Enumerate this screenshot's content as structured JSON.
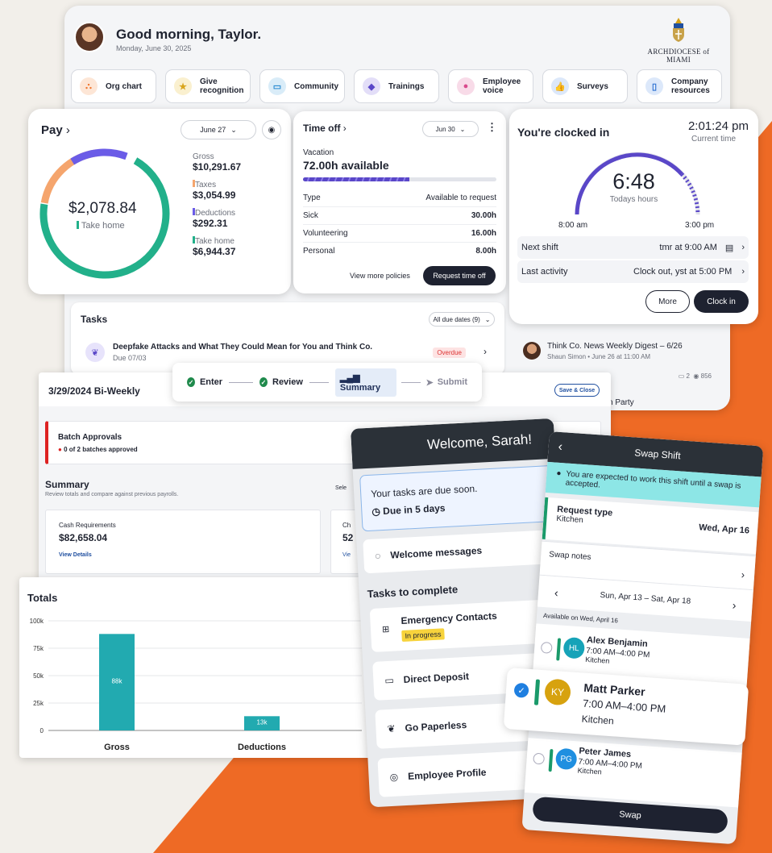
{
  "header": {
    "greeting": "Good morning, Taylor.",
    "date": "Monday, June 30, 2025",
    "org_logo_text": "ARCHDIOCESE of MIAMI"
  },
  "quick_actions": [
    {
      "label": "Org chart",
      "icon": "org-chart-icon",
      "color": "#f1742b"
    },
    {
      "label": "Give recognition",
      "icon": "star-icon",
      "color": "#d9a51c"
    },
    {
      "label": "Community",
      "icon": "chat-icon",
      "color": "#2a8bd1"
    },
    {
      "label": "Trainings",
      "icon": "graduation-cap-icon",
      "color": "#5a47c8"
    },
    {
      "label": "Employee voice",
      "icon": "microphone-icon",
      "color": "#d94a8c"
    },
    {
      "label": "Surveys",
      "icon": "thumbs-up-icon",
      "color": "#2a6fd1"
    },
    {
      "label": "Company resources",
      "icon": "book-icon",
      "color": "#2a6fd1"
    }
  ],
  "pay": {
    "title": "Pay",
    "period": "June 27",
    "amount": "$2,078.84",
    "amount_label": "Take home",
    "breakdown": [
      {
        "label": "Gross",
        "value": "$10,291.67",
        "color": ""
      },
      {
        "label": "Taxes",
        "value": "$3,054.99",
        "color": "#f5a56d"
      },
      {
        "label": "Deductions",
        "value": "$292.31",
        "color": "#6b5ce7"
      },
      {
        "label": "Take home",
        "value": "$6,944.37",
        "color": "#22b08a"
      }
    ]
  },
  "time_off": {
    "title": "Time off",
    "period": "Jun 30",
    "type": "Vacation",
    "available": "72.00h available",
    "progress": 0.55,
    "col_type": "Type",
    "col_avail": "Available to request",
    "rows": [
      {
        "type": "Sick",
        "hours": "30.00h"
      },
      {
        "type": "Volunteering",
        "hours": "16.00h"
      },
      {
        "type": "Personal",
        "hours": "8.00h"
      }
    ],
    "view_more": "View more policies",
    "request": "Request time off"
  },
  "clock": {
    "title": "You're clocked in",
    "time": "2:01:24 pm",
    "time_label": "Current time",
    "hours": "6:48",
    "hours_label": "Todays hours",
    "start": "8:00 am",
    "end": "3:00 pm",
    "next_label": "Next shift",
    "next_value": "tmr at 9:00 AM",
    "last_label": "Last activity",
    "last_value": "Clock out, yst at 5:00 PM",
    "more": "More",
    "clock_in": "Clock in"
  },
  "tasks": {
    "title": "Tasks",
    "filter": "All due dates (9)",
    "item_title": "Deepfake Attacks and What They Could Mean for You and Think Co.",
    "item_due": "Due 07/03",
    "item_status": "Overdue"
  },
  "news": {
    "title": "Think Co. News Weekly Digest – 6/26",
    "meta": "Shaun Simon • June 26 at 11:00 AM",
    "comments": "2",
    "views": "856",
    "snippet": "n Party"
  },
  "payroll": {
    "title": "3/29/2024 Bi-Weekly",
    "save": "Save & Close",
    "steps": [
      {
        "label": "Enter",
        "state": "done"
      },
      {
        "label": "Review",
        "state": "done"
      },
      {
        "label": "Summary",
        "state": "active"
      },
      {
        "label": "Submit",
        "state": "todo"
      }
    ],
    "batch_title": "Batch Approvals",
    "batch_status": "0 of 2 batches approved",
    "summary_title": "Summary",
    "summary_desc": "Review totals and compare against previous payrolls.",
    "select_label": "Sele",
    "cash_label": "Cash Requirements",
    "cash_value": "$82,658.04",
    "view_details": "View Details",
    "card2_label": "Ch",
    "card2_value": "52",
    "card2_link": "Vie"
  },
  "totals": {
    "title": "Totals"
  },
  "chart_data": {
    "type": "bar",
    "categories": [
      "Gross",
      "Deductions"
    ],
    "values": [
      88,
      13
    ],
    "value_labels": [
      "88k",
      "13k"
    ],
    "yticks": [
      "0",
      "25k",
      "50k",
      "75k",
      "100k"
    ],
    "ylim": [
      0,
      100
    ],
    "color": "#22aab0"
  },
  "mobile": {
    "welcome": "Welcome, Sarah!",
    "due_title": "Your tasks are due soon.",
    "due_value": "Due in 5 days",
    "welcome_messages": "Welcome messages",
    "tasks_heading": "Tasks to complete",
    "items": [
      {
        "label": "Emergency Contacts",
        "badge": "In progress",
        "icon": "first-aid-icon"
      },
      {
        "label": "Direct Deposit",
        "icon": "bank-card-icon"
      },
      {
        "label": "Go Paperless",
        "icon": "leaf-icon"
      },
      {
        "label": "Employee Profile",
        "icon": "profile-icon"
      }
    ]
  },
  "swap": {
    "title": "Swap Shift",
    "notice": "You are expected to work this shift until a swap is accepted.",
    "request_label": "Request type",
    "request_value": "Kitchen",
    "request_date": "Wed, Apr 16",
    "notes_label": "Swap notes",
    "range": "Sun, Apr 13 – Sat, Apr 18",
    "available": "Available on Wed, April 16",
    "people": [
      {
        "initials": "HL",
        "name": "Alex Benjamin",
        "time": "7:00 AM–4:00 PM",
        "dept": "Kitchen",
        "color": "#16a3b8"
      },
      {
        "initials": "KY",
        "name": "Matt Parker",
        "time": "7:00 AM–4:00 PM",
        "dept": "Kitchen",
        "color": "#d7a20f",
        "selected": true
      },
      {
        "initials": "PG",
        "name": "Peter James",
        "time": "7:00 AM–4:00 PM",
        "dept": "Kitchen",
        "color": "#1f8fe0"
      }
    ],
    "button": "Swap"
  }
}
